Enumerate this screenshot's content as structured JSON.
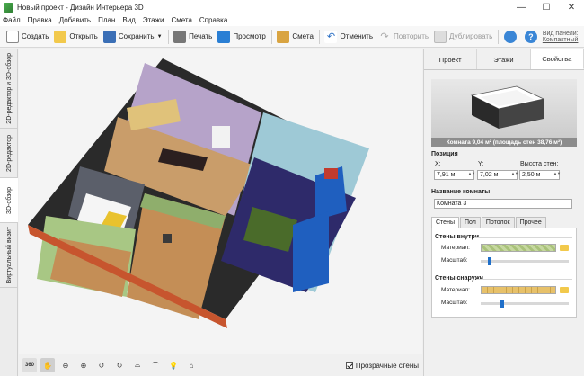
{
  "window": {
    "title": "Новый проект - Дизайн Интерьера 3D",
    "controls": [
      "—",
      "☐",
      "✕"
    ]
  },
  "menu": [
    "Файл",
    "Правка",
    "Добавить",
    "План",
    "Вид",
    "Этажи",
    "Смета",
    "Справка"
  ],
  "toolbar": {
    "create": "Создать",
    "open": "Открыть",
    "save": "Сохранить",
    "print": "Печать",
    "preview": "Просмотр",
    "estimate": "Смета",
    "undo": "Отменить",
    "redo": "Повторить",
    "duplicate": "Дублировать",
    "panel_view_label": "Вид панели:",
    "panel_view_value": "Компактный"
  },
  "left_tabs": [
    "2D-редактор и 3D-обзор",
    "2D-редактор",
    "3D-обзор",
    "Виртуальный визит"
  ],
  "bottom": {
    "btn_360": "360",
    "transparent_walls": "Прозрачные стены"
  },
  "right_panel": {
    "tabs": [
      "Проект",
      "Этажи",
      "Свойства"
    ],
    "preview_caption": "Комната 9,04 м² (площадь стен 38,76 м²)",
    "position_title": "Позиция",
    "x_label": "X:",
    "y_label": "Y:",
    "wall_height_label": "Высота стен:",
    "x_value": "7,91 м",
    "y_value": "7,02 м",
    "wall_height_value": "2,50 м",
    "room_name_title": "Название комнаты",
    "room_name_value": "Комната 3",
    "sub_tabs": [
      "Стены",
      "Пол",
      "Потолок",
      "Прочее"
    ],
    "inner_walls": {
      "title": "Стены внутри",
      "material_label": "Материал:",
      "scale_label": "Масштаб:",
      "scale_level": 0.08
    },
    "outer_walls": {
      "title": "Стены снаружи",
      "material_label": "Материал:",
      "scale_label": "Масштаб:",
      "scale_level": 0.22
    }
  }
}
